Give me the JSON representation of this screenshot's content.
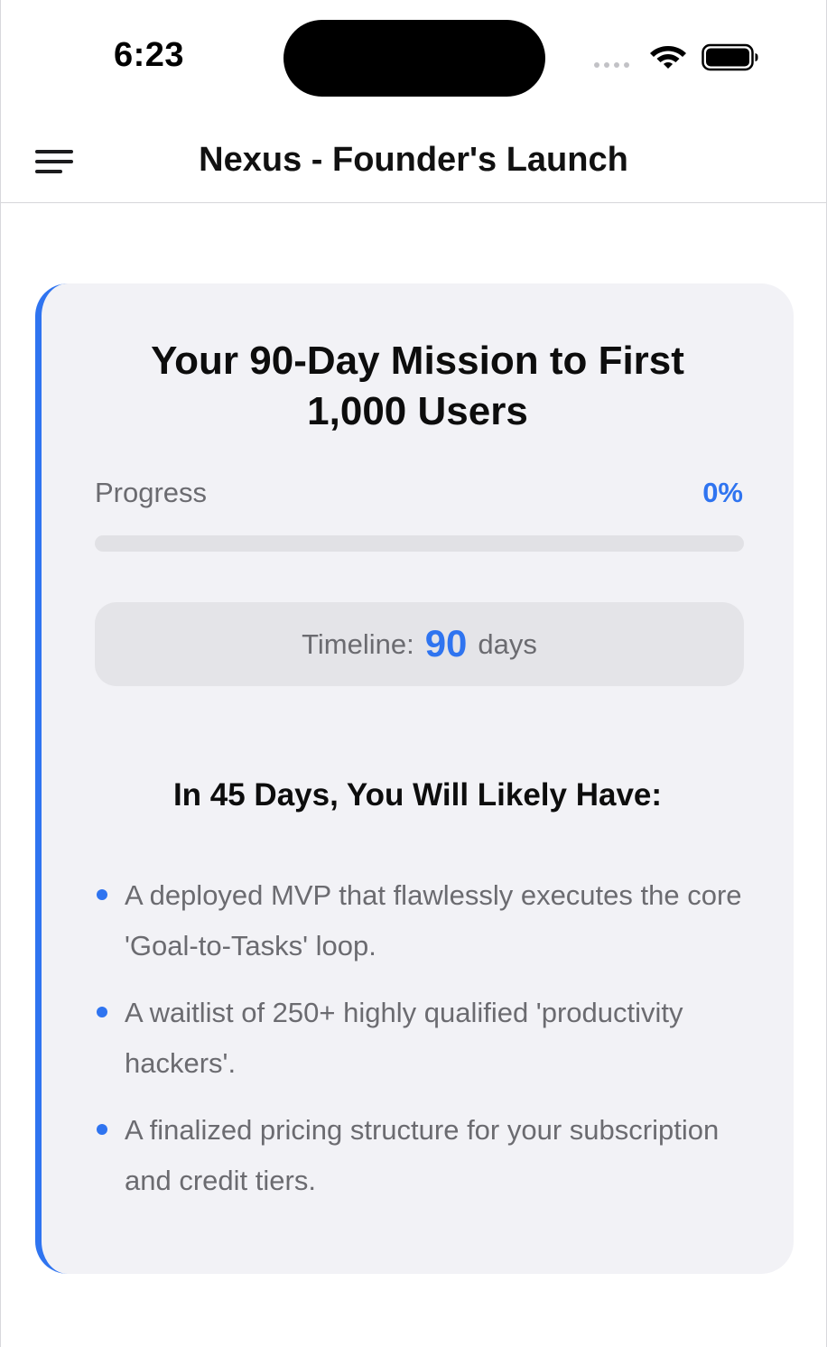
{
  "status_bar": {
    "time": "6:23",
    "icons": [
      "signal-dots-icon",
      "wifi-icon",
      "battery-icon"
    ]
  },
  "nav": {
    "title": "Nexus - Founder's Launch",
    "menu_icon": "hamburger-menu-icon"
  },
  "card": {
    "title": "Your 90-Day Mission to First 1,000 Users",
    "progress_label": "Progress",
    "progress_value": "0%",
    "progress_fraction": 0,
    "timeline_label": "Timeline:",
    "timeline_number": "90",
    "timeline_unit": "days",
    "outcomes_heading": "In 45 Days, You Will Likely Have:",
    "outcomes": [
      "A deployed MVP that flawlessly executes the core 'Goal-to-Tasks' loop.",
      "A waitlist of 250+ highly qualified 'productivity hackers'.",
      "A finalized pricing structure for your subscription and credit tiers."
    ]
  },
  "colors": {
    "accent": "#2f74f0",
    "card_background": "#f2f2f6",
    "muted_text": "#6b6b70",
    "track": "#e1e1e5"
  }
}
